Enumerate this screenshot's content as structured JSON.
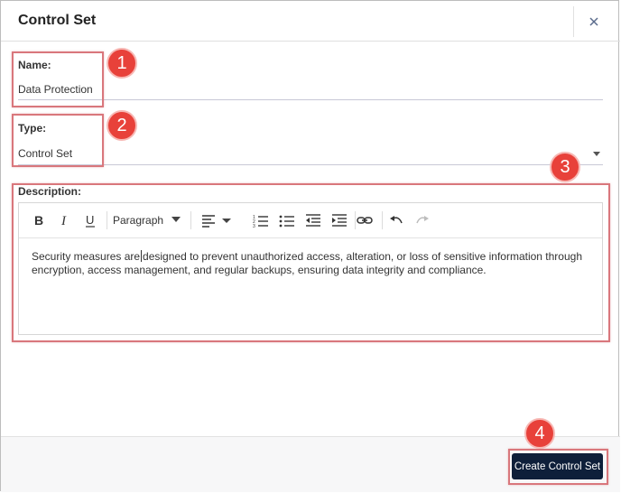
{
  "dialog": {
    "title": "Control Set",
    "close_icon": "close-icon"
  },
  "fields": {
    "name": {
      "label": "Name:",
      "value": "Data Protection"
    },
    "type": {
      "label": "Type:",
      "value": "Control Set"
    },
    "description": {
      "label": "Description:",
      "content_before_caret": "Security measures are",
      "content_after_caret": "designed to prevent unauthorized access, alteration, or loss of sensitive information through encryption, access management, and regular backups, ensuring data integrity and compliance."
    }
  },
  "toolbar": {
    "block_format": "Paragraph",
    "icons": [
      "bold-icon",
      "italic-icon",
      "underline-icon",
      "align-left-icon",
      "numbered-list-icon",
      "bullet-list-icon",
      "outdent-icon",
      "indent-icon",
      "link-icon",
      "undo-icon",
      "redo-icon"
    ]
  },
  "footer": {
    "create_label": "Create Control Set"
  },
  "annotations": [
    "1",
    "2",
    "3",
    "4"
  ],
  "colors": {
    "annotation_red": "#e8413a",
    "annotation_border": "#d9777c",
    "primary_button": "#0e1f3a"
  }
}
